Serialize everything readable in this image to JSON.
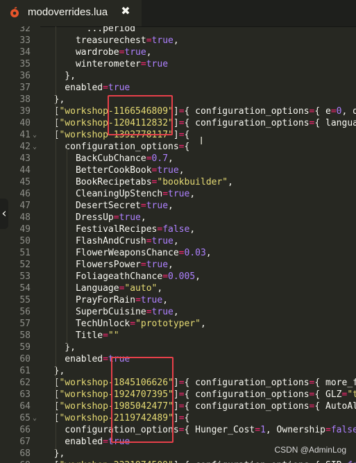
{
  "tab": {
    "title": "modoverrides.lua",
    "close_glyph": "✖",
    "icon": "lua-file-icon"
  },
  "watermark": "CSDN @AdminLog",
  "colors": {
    "background": "#272822",
    "keyword": "#f8f8f2",
    "operator": "#f92672",
    "number": "#ae81ff",
    "string": "#e6db74",
    "highlight_box": "#e8404a"
  },
  "lines": [
    {
      "n": "32",
      "fold": "",
      "tokens": [
        [
          "k",
          "        "
        ],
        [
          "k",
          "...period"
        ]
      ]
    },
    {
      "n": "33",
      "fold": "",
      "tokens": [
        [
          "k",
          "      treasurechest"
        ],
        [
          "op",
          "="
        ],
        [
          "bool",
          "true"
        ],
        [
          "k",
          ","
        ]
      ]
    },
    {
      "n": "34",
      "fold": "",
      "tokens": [
        [
          "k",
          "      wardrobe"
        ],
        [
          "op",
          "="
        ],
        [
          "bool",
          "true"
        ],
        [
          "k",
          ","
        ]
      ]
    },
    {
      "n": "35",
      "fold": "",
      "tokens": [
        [
          "k",
          "      winterometer"
        ],
        [
          "op",
          "="
        ],
        [
          "bool",
          "true"
        ]
      ]
    },
    {
      "n": "36",
      "fold": "",
      "tokens": [
        [
          "k",
          "    },"
        ]
      ]
    },
    {
      "n": "37",
      "fold": "",
      "tokens": [
        [
          "k",
          "    enabled"
        ],
        [
          "op",
          "="
        ],
        [
          "bool",
          "true"
        ]
      ]
    },
    {
      "n": "38",
      "fold": "",
      "tokens": [
        [
          "k",
          "  },"
        ]
      ]
    },
    {
      "n": "39",
      "fold": "",
      "tokens": [
        [
          "k",
          "  ["
        ],
        [
          "str",
          "\"workshop-1166546809\""
        ],
        [
          "k",
          "]"
        ],
        [
          "op",
          "="
        ],
        [
          "k",
          "{ configuration_options"
        ],
        [
          "op",
          "="
        ],
        [
          "k",
          "{ e"
        ],
        [
          "op",
          "="
        ],
        [
          "num",
          "0"
        ],
        [
          "k",
          ", q"
        ],
        [
          "op",
          "="
        ]
      ]
    },
    {
      "n": "40",
      "fold": "",
      "tokens": [
        [
          "k",
          "  ["
        ],
        [
          "str",
          "\"workshop-1204112832\""
        ],
        [
          "k",
          "]"
        ],
        [
          "op",
          "="
        ],
        [
          "k",
          "{ configuration_options"
        ],
        [
          "op",
          "="
        ],
        [
          "k",
          "{ languag"
        ]
      ]
    },
    {
      "n": "41",
      "fold": "⌄",
      "tokens": [
        [
          "k",
          "  ["
        ],
        [
          "str",
          "\"workshop-1392778117\""
        ],
        [
          "k",
          "]"
        ],
        [
          "op",
          "="
        ],
        [
          "k",
          "{"
        ]
      ]
    },
    {
      "n": "42",
      "fold": "⌄",
      "tokens": [
        [
          "k",
          "    configuration_options"
        ],
        [
          "op",
          "="
        ],
        [
          "k",
          "{"
        ]
      ]
    },
    {
      "n": "43",
      "fold": "",
      "tokens": [
        [
          "k",
          "      BackCubChance"
        ],
        [
          "op",
          "="
        ],
        [
          "num",
          "0.7"
        ],
        [
          "k",
          ","
        ]
      ]
    },
    {
      "n": "44",
      "fold": "",
      "tokens": [
        [
          "k",
          "      BetterCookBook"
        ],
        [
          "op",
          "="
        ],
        [
          "bool",
          "true"
        ],
        [
          "k",
          ","
        ]
      ]
    },
    {
      "n": "45",
      "fold": "",
      "tokens": [
        [
          "k",
          "      BookRecipetabs"
        ],
        [
          "op",
          "="
        ],
        [
          "str",
          "\"bookbuilder\""
        ],
        [
          "k",
          ","
        ]
      ]
    },
    {
      "n": "46",
      "fold": "",
      "tokens": [
        [
          "k",
          "      CleaningUpStench"
        ],
        [
          "op",
          "="
        ],
        [
          "bool",
          "true"
        ],
        [
          "k",
          ","
        ]
      ]
    },
    {
      "n": "47",
      "fold": "",
      "tokens": [
        [
          "k",
          "      DesertSecret"
        ],
        [
          "op",
          "="
        ],
        [
          "bool",
          "true"
        ],
        [
          "k",
          ","
        ]
      ]
    },
    {
      "n": "48",
      "fold": "",
      "tokens": [
        [
          "k",
          "      DressUp"
        ],
        [
          "op",
          "="
        ],
        [
          "bool",
          "true"
        ],
        [
          "k",
          ","
        ]
      ]
    },
    {
      "n": "49",
      "fold": "",
      "tokens": [
        [
          "k",
          "      FestivalRecipes"
        ],
        [
          "op",
          "="
        ],
        [
          "bool",
          "false"
        ],
        [
          "k",
          ","
        ]
      ]
    },
    {
      "n": "50",
      "fold": "",
      "tokens": [
        [
          "k",
          "      FlashAndCrush"
        ],
        [
          "op",
          "="
        ],
        [
          "bool",
          "true"
        ],
        [
          "k",
          ","
        ]
      ]
    },
    {
      "n": "51",
      "fold": "",
      "tokens": [
        [
          "k",
          "      FlowerWeaponsChance"
        ],
        [
          "op",
          "="
        ],
        [
          "num",
          "0.03"
        ],
        [
          "k",
          ","
        ]
      ]
    },
    {
      "n": "52",
      "fold": "",
      "tokens": [
        [
          "k",
          "      FlowersPower"
        ],
        [
          "op",
          "="
        ],
        [
          "bool",
          "true"
        ],
        [
          "k",
          ","
        ]
      ]
    },
    {
      "n": "53",
      "fold": "",
      "tokens": [
        [
          "k",
          "      FoliageathChance"
        ],
        [
          "op",
          "="
        ],
        [
          "num",
          "0.005"
        ],
        [
          "k",
          ","
        ]
      ]
    },
    {
      "n": "54",
      "fold": "",
      "tokens": [
        [
          "k",
          "      Language"
        ],
        [
          "op",
          "="
        ],
        [
          "str",
          "\"auto\""
        ],
        [
          "k",
          ","
        ]
      ]
    },
    {
      "n": "55",
      "fold": "",
      "tokens": [
        [
          "k",
          "      PrayForRain"
        ],
        [
          "op",
          "="
        ],
        [
          "bool",
          "true"
        ],
        [
          "k",
          ","
        ]
      ]
    },
    {
      "n": "56",
      "fold": "",
      "tokens": [
        [
          "k",
          "      SuperbCuisine"
        ],
        [
          "op",
          "="
        ],
        [
          "bool",
          "true"
        ],
        [
          "k",
          ","
        ]
      ]
    },
    {
      "n": "57",
      "fold": "",
      "tokens": [
        [
          "k",
          "      TechUnlock"
        ],
        [
          "op",
          "="
        ],
        [
          "str",
          "\"prototyper\""
        ],
        [
          "k",
          ","
        ]
      ]
    },
    {
      "n": "58",
      "fold": "",
      "tokens": [
        [
          "k",
          "      Title"
        ],
        [
          "op",
          "="
        ],
        [
          "str",
          "\"\""
        ]
      ]
    },
    {
      "n": "59",
      "fold": "",
      "tokens": [
        [
          "k",
          "    },"
        ]
      ]
    },
    {
      "n": "60",
      "fold": "",
      "tokens": [
        [
          "k",
          "    enabled"
        ],
        [
          "op",
          "="
        ],
        [
          "bool",
          "true"
        ]
      ]
    },
    {
      "n": "61",
      "fold": "",
      "tokens": [
        [
          "k",
          "  },"
        ]
      ]
    },
    {
      "n": "62",
      "fold": "",
      "tokens": [
        [
          "k",
          "  ["
        ],
        [
          "str",
          "\"workshop-1845106626\""
        ],
        [
          "k",
          "]"
        ],
        [
          "op",
          "="
        ],
        [
          "k",
          "{ configuration_options"
        ],
        [
          "op",
          "="
        ],
        [
          "k",
          "{ more_fu"
        ]
      ]
    },
    {
      "n": "63",
      "fold": "",
      "tokens": [
        [
          "k",
          "  ["
        ],
        [
          "str",
          "\"workshop-1924707395\""
        ],
        [
          "k",
          "]"
        ],
        [
          "op",
          "="
        ],
        [
          "k",
          "{ configuration_options"
        ],
        [
          "op",
          "="
        ],
        [
          "k",
          "{ GLZ"
        ],
        [
          "op",
          "="
        ],
        [
          "str",
          "\"tr"
        ]
      ]
    },
    {
      "n": "64",
      "fold": "",
      "tokens": [
        [
          "k",
          "  ["
        ],
        [
          "str",
          "\"workshop-1985042477\""
        ],
        [
          "k",
          "]"
        ],
        [
          "op",
          "="
        ],
        [
          "k",
          "{ configuration_options"
        ],
        [
          "op",
          "="
        ],
        [
          "k",
          "{ AutoAli"
        ]
      ]
    },
    {
      "n": "65",
      "fold": "⌄",
      "tokens": [
        [
          "k",
          "  ["
        ],
        [
          "str",
          "\"workshop-2119742489\""
        ],
        [
          "k",
          "]"
        ],
        [
          "op",
          "="
        ],
        [
          "k",
          "{"
        ]
      ]
    },
    {
      "n": "66",
      "fold": "",
      "tokens": [
        [
          "k",
          "    configuration_options"
        ],
        [
          "op",
          "="
        ],
        [
          "k",
          "{ Hunger_Cost"
        ],
        [
          "op",
          "="
        ],
        [
          "num",
          "1"
        ],
        [
          "k",
          ", Ownership"
        ],
        [
          "op",
          "="
        ],
        [
          "bool",
          "false"
        ],
        [
          "k",
          ","
        ]
      ]
    },
    {
      "n": "67",
      "fold": "",
      "tokens": [
        [
          "k",
          "    enabled"
        ],
        [
          "op",
          "="
        ],
        [
          "bool",
          "true"
        ]
      ]
    },
    {
      "n": "68",
      "fold": "",
      "tokens": [
        [
          "k",
          "  },"
        ]
      ]
    },
    {
      "n": "69",
      "fold": "",
      "tokens": [
        [
          "k",
          "  ["
        ],
        [
          "str",
          "\"workshop-2321974509\""
        ],
        [
          "k",
          "]"
        ],
        [
          "op",
          "="
        ],
        [
          "k",
          "{ configuration_options"
        ],
        [
          "op",
          "="
        ],
        [
          "k",
          "{ SIB"
        ],
        [
          "op",
          "="
        ],
        [
          "bool",
          "fal"
        ]
      ]
    }
  ]
}
